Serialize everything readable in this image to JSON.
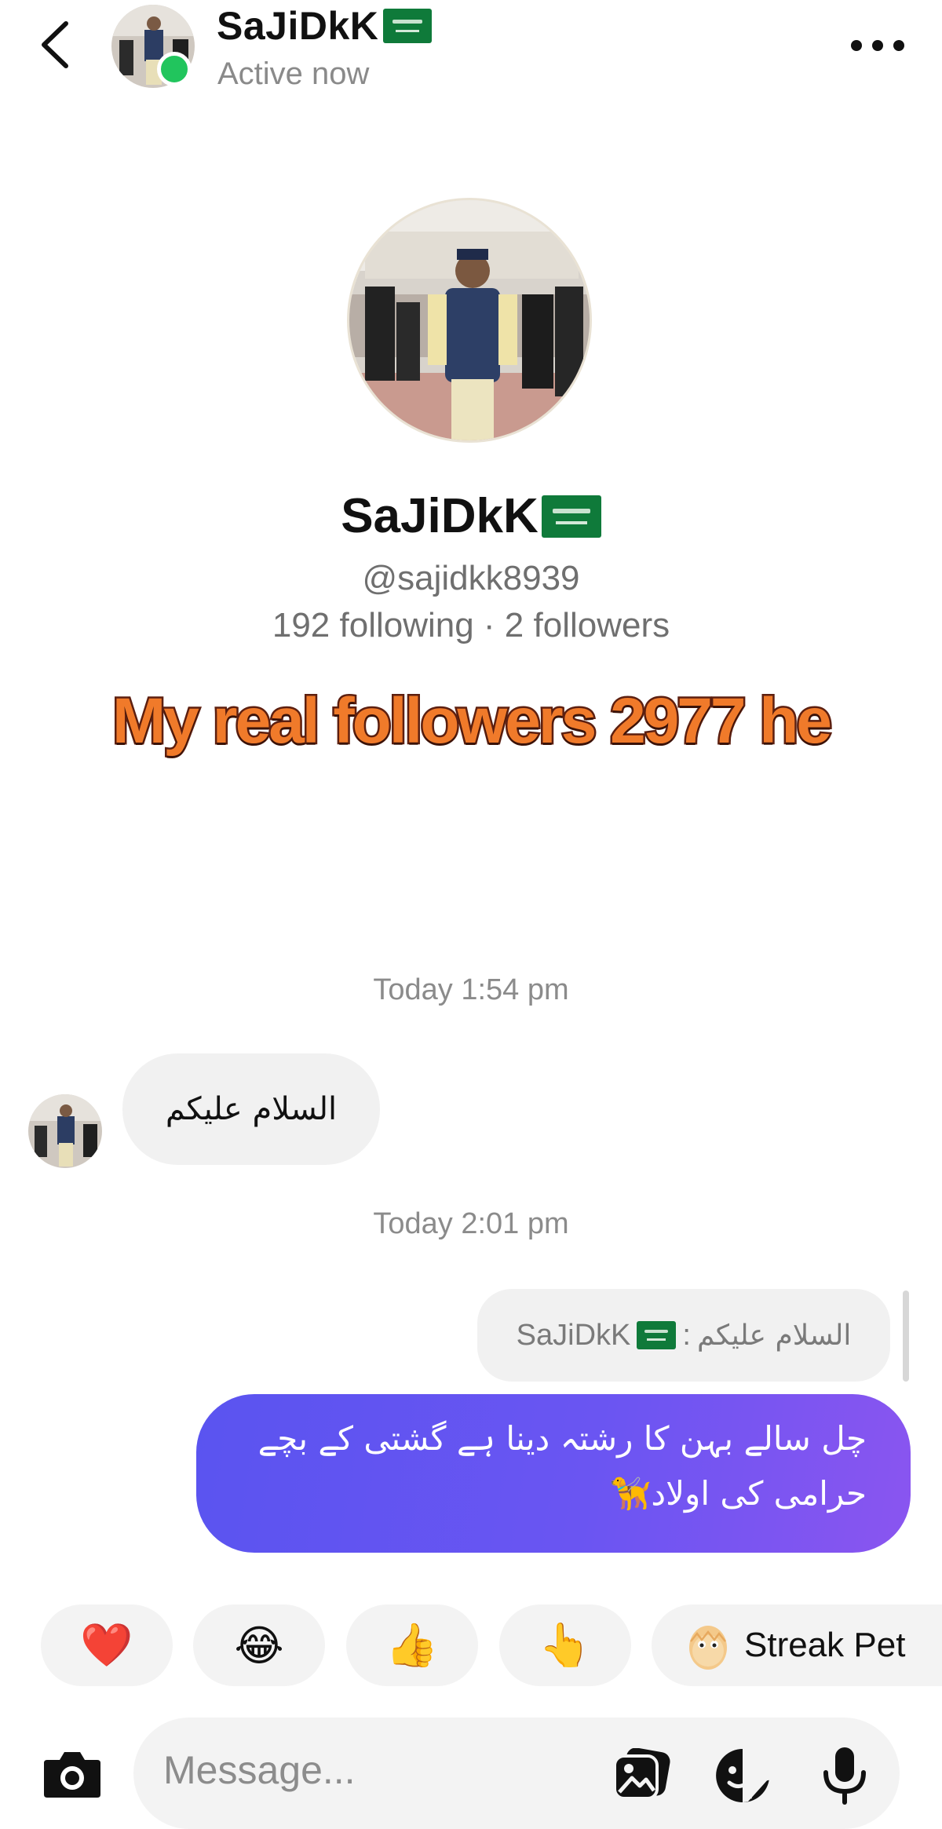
{
  "header": {
    "back_icon": "chevron-left-icon",
    "contact_name": "SaJiDkK",
    "status": "Active now",
    "more_icon": "more-horizontal-icon"
  },
  "profile": {
    "name": "SaJiDkK",
    "handle": "@sajidkk8939",
    "stats": "192 following · 2 followers",
    "overlay_caption": "My real followers 2977 he"
  },
  "messages": [
    {
      "timestamp": "Today 1:54 pm",
      "direction": "incoming",
      "text": "السلام علیکم"
    },
    {
      "timestamp": "Today 2:01 pm",
      "direction": "outgoing",
      "reply_to": {
        "author": "SaJiDkK",
        "text": "السلام علیکم"
      },
      "lines": [
        "چل سالے بہن کا رشتہ دینا ہے گشتی کے بچے",
        "حرامی کی اولاد"
      ],
      "emoji": "🦮"
    }
  ],
  "quick_reactions": [
    {
      "icon": "heart-emoji",
      "emoji": "❤️"
    },
    {
      "icon": "laughing-emoji",
      "emoji": "😂"
    },
    {
      "icon": "thumbs-up-emoji",
      "emoji": "👍"
    },
    {
      "icon": "pointing-hand-emoji",
      "emoji": "👆"
    },
    {
      "icon": "egg-pet-icon",
      "label": "Streak Pet"
    }
  ],
  "composer": {
    "placeholder": "Message...",
    "icons": [
      "camera-icon",
      "gallery-icon",
      "sticker-icon",
      "microphone-icon"
    ]
  },
  "colors": {
    "online": "#21c55d",
    "bubble_out_start": "#5a54f0",
    "bubble_out_end": "#8a55f0",
    "bubble_in": "#f1f1f1",
    "overlay_text": "#f07a2a"
  }
}
